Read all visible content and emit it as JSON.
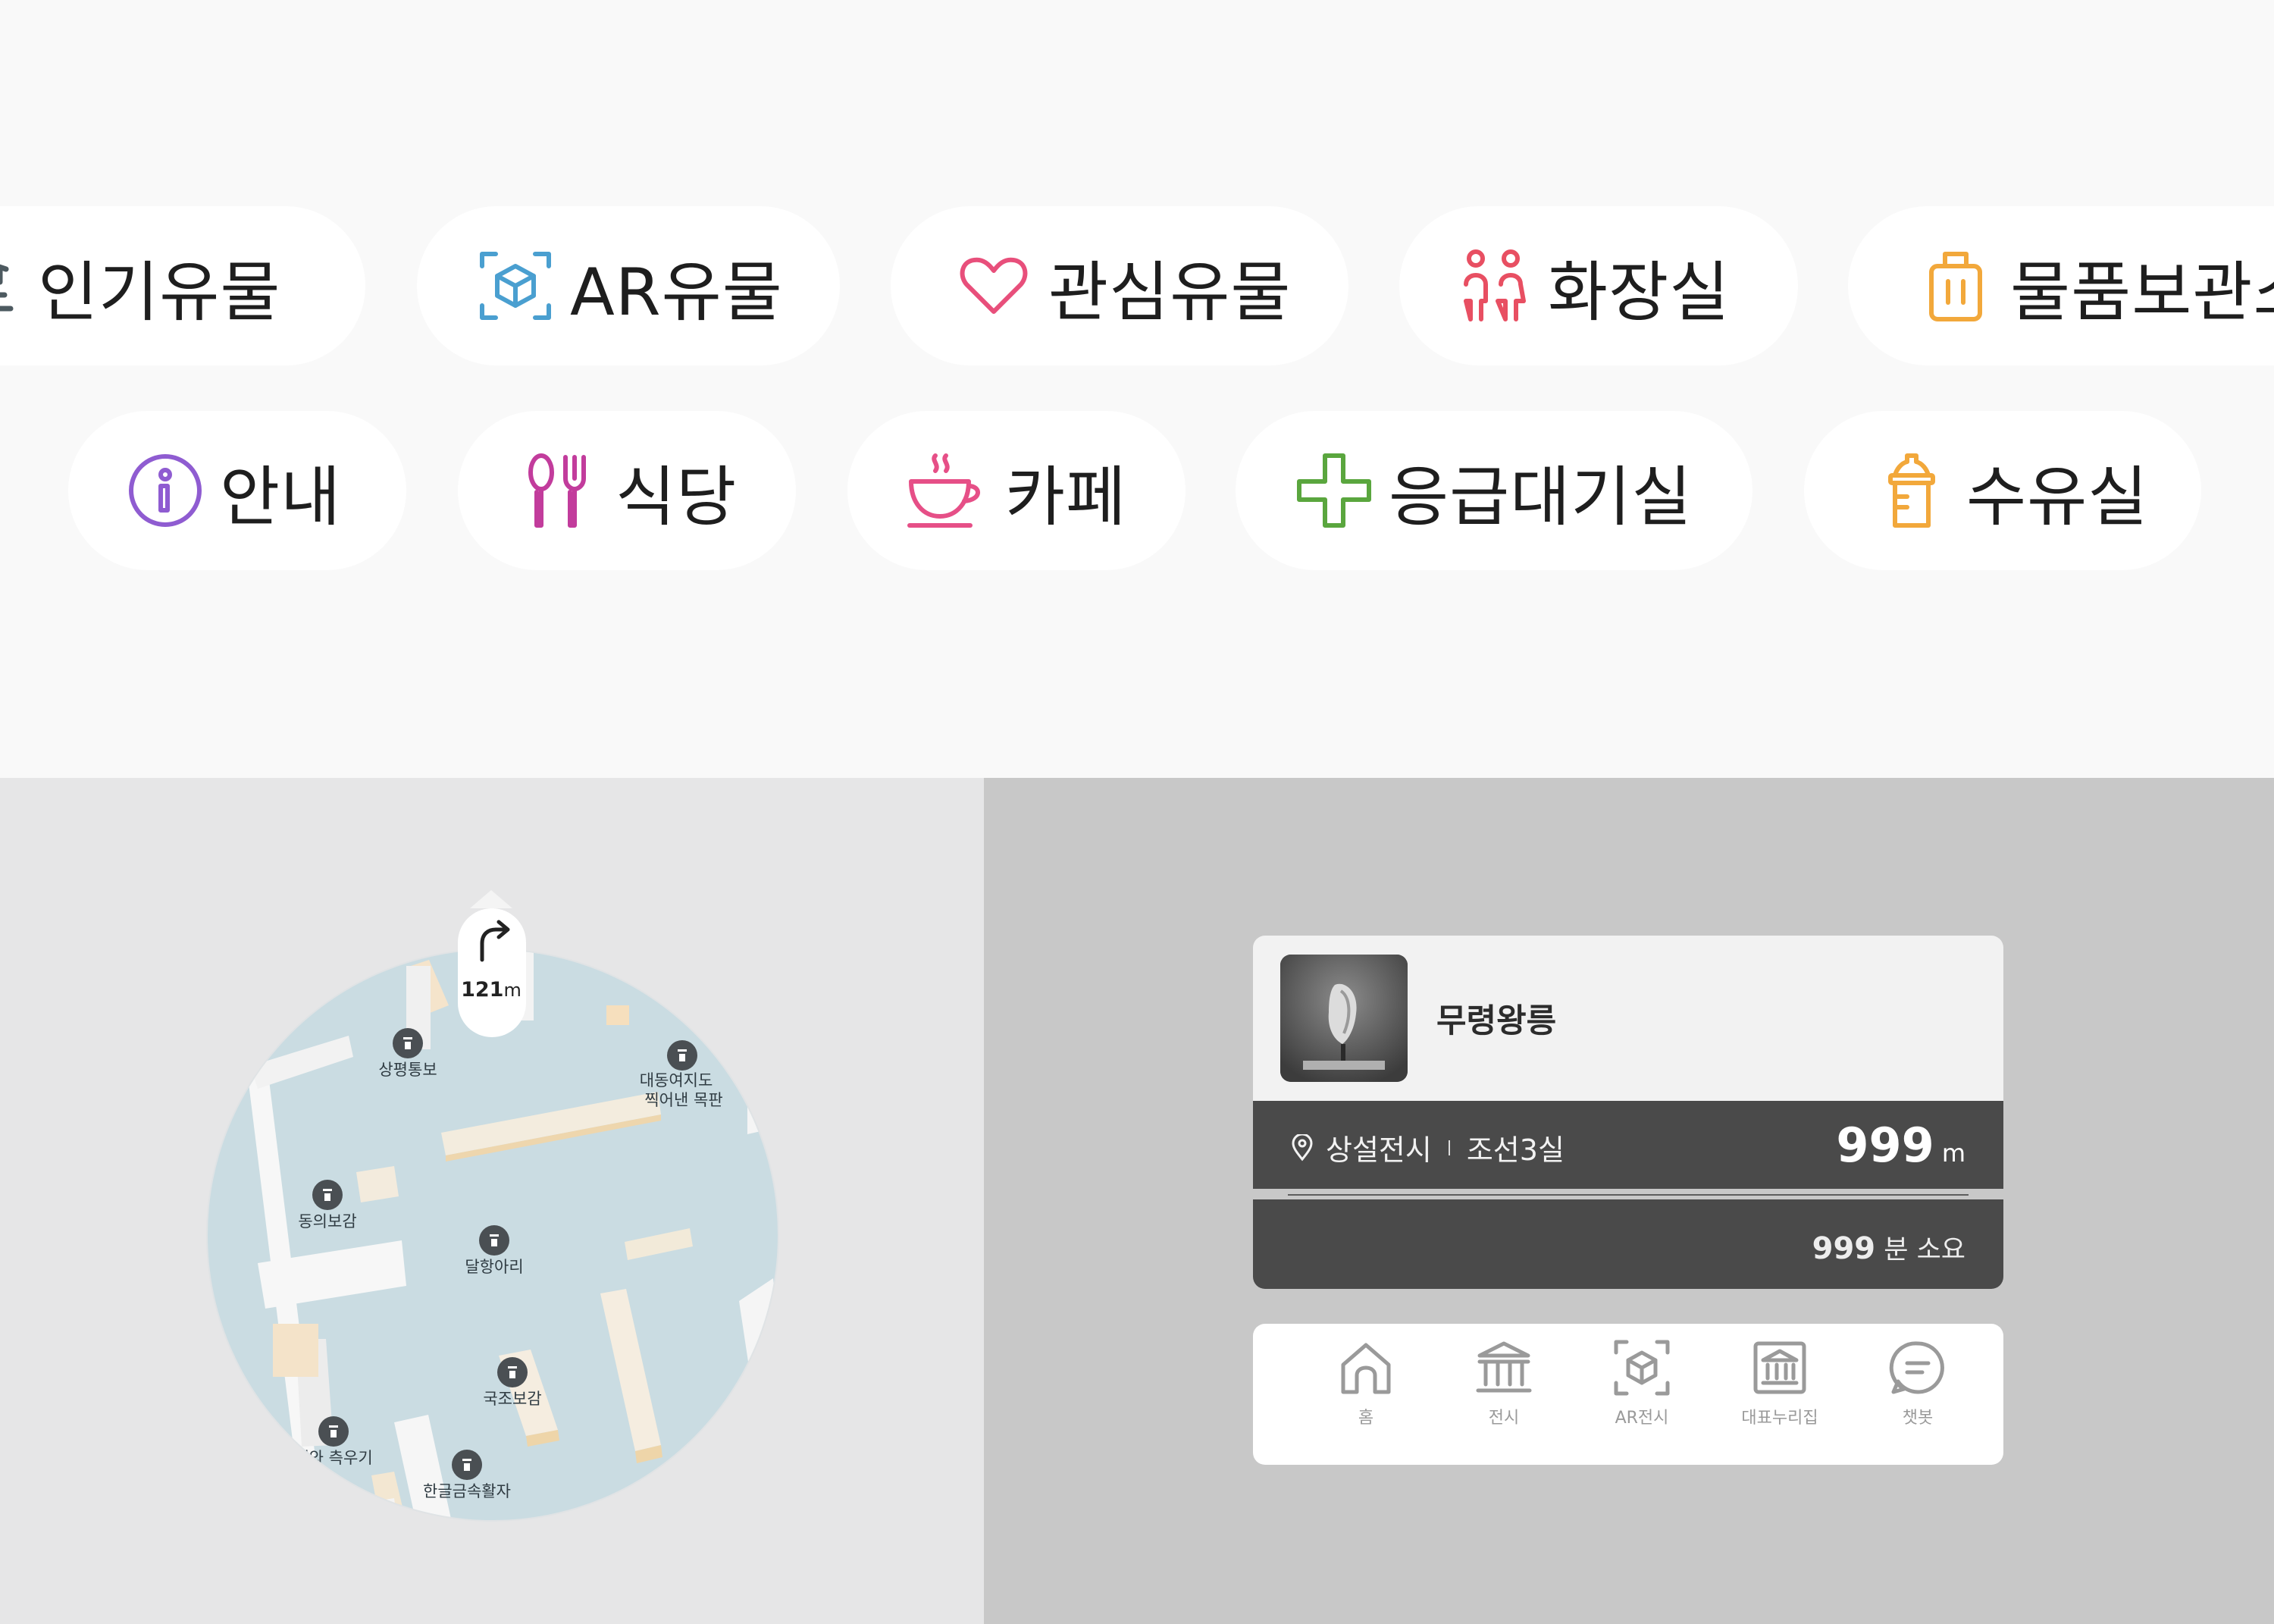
{
  "filters": {
    "row1": [
      {
        "label": "인기유물",
        "icon": "popular-artifact-icon",
        "color": "#4d5a60"
      },
      {
        "label": "AR유물",
        "icon": "ar-cube-icon",
        "color": "#4a9fd0"
      },
      {
        "label": "관심유물",
        "icon": "heart-icon",
        "color": "#e84f7b"
      },
      {
        "label": "화장실",
        "icon": "restroom-icon",
        "color": "#e84f62"
      },
      {
        "label": "물품보관소",
        "icon": "luggage-icon",
        "color": "#f2a83b"
      }
    ],
    "row2": [
      {
        "label": "안내",
        "icon": "info-icon",
        "color": "#8f5cd1"
      },
      {
        "label": "식당",
        "icon": "restaurant-icon",
        "color": "#c23c9c"
      },
      {
        "label": "카페",
        "icon": "coffee-cup-icon",
        "color": "#e64f87"
      },
      {
        "label": "응급대기실",
        "icon": "medical-cross-icon",
        "color": "#5aa63e"
      },
      {
        "label": "수유실",
        "icon": "baby-bottle-icon",
        "color": "#f2a83b"
      }
    ]
  },
  "minimap": {
    "direction": {
      "icon": "turn-right-icon",
      "distance": "121",
      "unit": "m"
    },
    "labels": {
      "l1": "상평통보",
      "l2a": "대동여지도",
      "l2b": "찍어낸 목판",
      "l3": "동의보감",
      "l4": "달항아리",
      "l5": "국조보감",
      "l6": "해와 측우기",
      "l7": "한글금속활자"
    }
  },
  "artifact_card": {
    "title": "무령왕릉",
    "location": "상설전시",
    "room": "조선3실",
    "distance": "999",
    "distance_unit": "m",
    "time_value": "999",
    "time_suffix": "분 소요"
  },
  "bottom_nav": [
    {
      "label": "홈",
      "icon": "home-icon"
    },
    {
      "label": "전시",
      "icon": "museum-icon"
    },
    {
      "label": "AR전시",
      "icon": "ar-cube-icon"
    },
    {
      "label": "대표누리집",
      "icon": "museum-framed-icon"
    },
    {
      "label": "챗봇",
      "icon": "chat-bubble-icon"
    }
  ]
}
